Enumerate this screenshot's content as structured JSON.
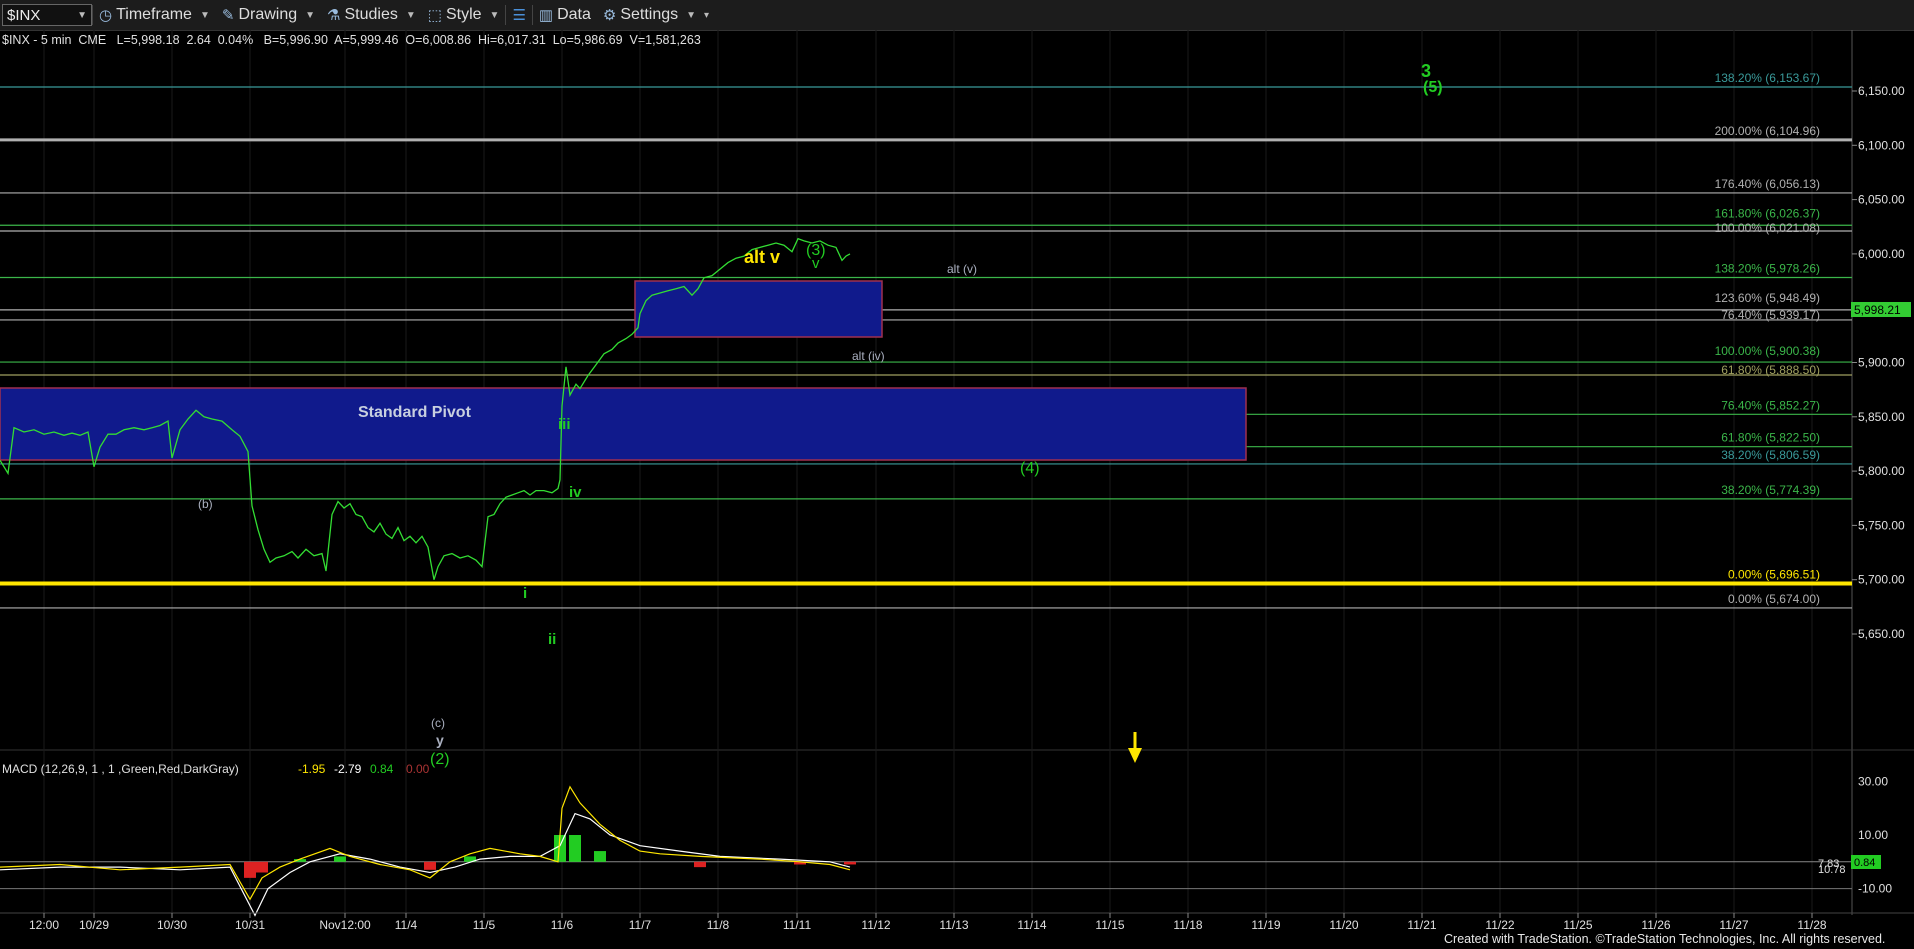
{
  "toolbar": {
    "symbol": "$INX",
    "timeframe": "Timeframe",
    "drawing": "Drawing",
    "studies": "Studies",
    "style": "Style",
    "data": "Data",
    "settings": "Settings"
  },
  "quote_line": "$INX - 5 min  CME   L=5,998.18  2.64  0.04%   B=5,996.90  A=5,999.46  O=6,008.86  Hi=6,017.31  Lo=5,986.69  V=1,581,263",
  "chart_data": {
    "type": "line",
    "symbol": "$INX",
    "interval": "5 min",
    "exchange": "CME",
    "last": "5,998.21",
    "ylim": [
      5630,
      6190
    ],
    "y_ticks": [
      "6,150.00",
      "6,100.00",
      "6,050.00",
      "6,000.00",
      "5,950.00",
      "5,900.00",
      "5,850.00",
      "5,800.00",
      "5,750.00",
      "5,700.00",
      "5,650.00"
    ],
    "x_ticks": [
      "12:00",
      "10/29",
      "10/30",
      "10/31",
      "Nov12:00",
      "11/4",
      "11/5",
      "11/6",
      "11/7",
      "11/8",
      "11/11",
      "11/12",
      "11/13",
      "11/14",
      "11/15",
      "11/18",
      "11/19",
      "11/20",
      "11/21",
      "11/22",
      "11/25",
      "11/26",
      "11/27",
      "11/28"
    ],
    "fib_levels": [
      {
        "label": "138.20% (6,153.67)",
        "price": 6153.67,
        "color": "#3a9a9a"
      },
      {
        "label": "200.00% (6,104.96)",
        "price": 6104.96,
        "color": "#b0b0b0"
      },
      {
        "label": "176.40% (6,056.13)",
        "price": 6056.13,
        "color": "#b0b0b0"
      },
      {
        "label": "161.80% (6,026.37)",
        "price": 6026.37,
        "color": "#3bb64a"
      },
      {
        "label": "100.00% (6,021.08)",
        "price": 6021.08,
        "color": "#b0b0b0"
      },
      {
        "label": "138.20% (5,978.26)",
        "price": 5978.26,
        "color": "#3bb64a"
      },
      {
        "label": "123.60% (5,948.49)",
        "price": 5948.49,
        "color": "#b0b0b0"
      },
      {
        "label": "76.40% (5,939.17)",
        "price": 5939.17,
        "color": "#b0b0b0"
      },
      {
        "label": "100.00% (5,900.38)",
        "price": 5900.38,
        "color": "#3bb64a"
      },
      {
        "label": "61.80% (5,888.50)",
        "price": 5888.5,
        "color": "#a0a060"
      },
      {
        "label": "76.40% (5,852.27)",
        "price": 5852.27,
        "color": "#3bb64a"
      },
      {
        "label": "61.80% (5,822.50)",
        "price": 5822.5,
        "color": "#3bb64a"
      },
      {
        "label": "38.20% (5,806.59)",
        "price": 5806.59,
        "color": "#3a9a9a"
      },
      {
        "label": "38.20% (5,774.39)",
        "price": 5774.39,
        "color": "#3bb64a"
      },
      {
        "label": "0.00% (5,696.51)",
        "price": 5696.51,
        "color": "#ffe600"
      },
      {
        "label": "0.00% (5,674.00)",
        "price": 5674.0,
        "color": "#b0b0b0"
      }
    ],
    "pivot_label": "Standard Pivot",
    "wave_labels": [
      {
        "text": "3",
        "color": "#22cc22"
      },
      {
        "text": "(5)",
        "color": "#22cc22"
      },
      {
        "text": "alt v",
        "color": "#ffe600"
      },
      {
        "text": "(3)",
        "color": "#22cc22"
      },
      {
        "text": "v",
        "color": "#22cc22"
      },
      {
        "text": "alt (v)",
        "color": "#aab0c0"
      },
      {
        "text": "alt (iv)",
        "color": "#aab0c0"
      },
      {
        "text": "iii",
        "color": "#22cc22"
      },
      {
        "text": "iv",
        "color": "#22cc22"
      },
      {
        "text": "(4)",
        "color": "#22cc22"
      },
      {
        "text": "(b)",
        "color": "#aab0c0"
      },
      {
        "text": "i",
        "color": "#22cc22"
      },
      {
        "text": "ii",
        "color": "#22cc22"
      },
      {
        "text": "(c)",
        "color": "#aab0c0"
      },
      {
        "text": "y",
        "color": "#aab0c0"
      },
      {
        "text": "(2)",
        "color": "#22cc22"
      }
    ],
    "price_path": [
      [
        0,
        5810
      ],
      [
        8,
        5798
      ],
      [
        14,
        5840
      ],
      [
        24,
        5836
      ],
      [
        34,
        5838
      ],
      [
        44,
        5834
      ],
      [
        54,
        5836
      ],
      [
        64,
        5833
      ],
      [
        72,
        5835
      ],
      [
        80,
        5833
      ],
      [
        88,
        5836
      ],
      [
        94,
        5804
      ],
      [
        100,
        5822
      ],
      [
        108,
        5834
      ],
      [
        116,
        5834
      ],
      [
        124,
        5838
      ],
      [
        134,
        5840
      ],
      [
        144,
        5838
      ],
      [
        152,
        5840
      ],
      [
        160,
        5842
      ],
      [
        168,
        5846
      ],
      [
        172,
        5812
      ],
      [
        180,
        5838
      ],
      [
        188,
        5848
      ],
      [
        196,
        5856
      ],
      [
        204,
        5850
      ],
      [
        212,
        5848
      ],
      [
        222,
        5846
      ],
      [
        232,
        5838
      ],
      [
        240,
        5832
      ],
      [
        248,
        5818
      ],
      [
        252,
        5768
      ],
      [
        258,
        5746
      ],
      [
        264,
        5728
      ],
      [
        270,
        5716
      ],
      [
        276,
        5720
      ],
      [
        284,
        5722
      ],
      [
        292,
        5726
      ],
      [
        298,
        5720
      ],
      [
        306,
        5728
      ],
      [
        314,
        5722
      ],
      [
        322,
        5724
      ],
      [
        326,
        5708
      ],
      [
        332,
        5760
      ],
      [
        338,
        5772
      ],
      [
        344,
        5766
      ],
      [
        350,
        5770
      ],
      [
        356,
        5760
      ],
      [
        362,
        5758
      ],
      [
        368,
        5748
      ],
      [
        374,
        5744
      ],
      [
        380,
        5752
      ],
      [
        386,
        5742
      ],
      [
        392,
        5738
      ],
      [
        398,
        5748
      ],
      [
        404,
        5736
      ],
      [
        410,
        5740
      ],
      [
        416,
        5734
      ],
      [
        422,
        5740
      ],
      [
        428,
        5730
      ],
      [
        434,
        5700
      ],
      [
        438,
        5712
      ],
      [
        444,
        5722
      ],
      [
        452,
        5724
      ],
      [
        460,
        5720
      ],
      [
        468,
        5722
      ],
      [
        476,
        5718
      ],
      [
        482,
        5712
      ],
      [
        488,
        5758
      ],
      [
        494,
        5760
      ],
      [
        500,
        5770
      ],
      [
        506,
        5776
      ],
      [
        512,
        5778
      ],
      [
        518,
        5780
      ],
      [
        524,
        5782
      ],
      [
        530,
        5778
      ],
      [
        536,
        5782
      ],
      [
        544,
        5782
      ],
      [
        552,
        5780
      ],
      [
        558,
        5784
      ],
      [
        560,
        5792
      ],
      [
        562,
        5860
      ],
      [
        566,
        5896
      ],
      [
        570,
        5870
      ],
      [
        576,
        5880
      ],
      [
        580,
        5876
      ],
      [
        588,
        5888
      ],
      [
        596,
        5898
      ],
      [
        604,
        5908
      ],
      [
        612,
        5912
      ],
      [
        618,
        5918
      ],
      [
        626,
        5922
      ],
      [
        632,
        5926
      ],
      [
        638,
        5932
      ],
      [
        640,
        5945
      ],
      [
        646,
        5957
      ],
      [
        652,
        5962
      ],
      [
        660,
        5964
      ],
      [
        668,
        5966
      ],
      [
        676,
        5968
      ],
      [
        684,
        5970
      ],
      [
        692,
        5962
      ],
      [
        698,
        5968
      ],
      [
        704,
        5978
      ],
      [
        712,
        5980
      ],
      [
        720,
        5986
      ],
      [
        728,
        5992
      ],
      [
        736,
        5996
      ],
      [
        744,
        5998
      ],
      [
        752,
        6004
      ],
      [
        760,
        6006
      ],
      [
        768,
        6008
      ],
      [
        776,
        6010
      ],
      [
        784,
        6008
      ],
      [
        792,
        6002
      ],
      [
        798,
        6014
      ],
      [
        804,
        6012
      ],
      [
        812,
        6010
      ],
      [
        820,
        6012
      ],
      [
        828,
        6008
      ],
      [
        836,
        6006
      ],
      [
        842,
        5994
      ],
      [
        846,
        5998
      ],
      [
        850,
        6000
      ]
    ],
    "macd": {
      "label": "MACD (12,26,9, 1 , 1 ,Green,Red,DarkGray)",
      "values": [
        "-1.95",
        "-2.79",
        "0.84",
        "0.00"
      ],
      "value_colors": [
        "#ffe600",
        "#ffffff",
        "#22cc22",
        "#aa3333"
      ],
      "y_ticks": [
        "30.00",
        "10.00",
        "-10.00"
      ],
      "ylim": [
        -18,
        38
      ],
      "last_labels": [
        "7.83",
        "0.84",
        "10.78"
      ],
      "macd_line": [
        [
          0,
          -2
        ],
        [
          60,
          -1
        ],
        [
          120,
          -3
        ],
        [
          180,
          -2
        ],
        [
          230,
          -1
        ],
        [
          250,
          -14
        ],
        [
          262,
          -6
        ],
        [
          280,
          -2
        ],
        [
          300,
          1
        ],
        [
          330,
          5
        ],
        [
          350,
          2
        ],
        [
          380,
          -1
        ],
        [
          410,
          -3
        ],
        [
          430,
          -6
        ],
        [
          450,
          0
        ],
        [
          470,
          3
        ],
        [
          490,
          5
        ],
        [
          520,
          3
        ],
        [
          540,
          2
        ],
        [
          558,
          0
        ],
        [
          562,
          20
        ],
        [
          570,
          28
        ],
        [
          580,
          22
        ],
        [
          600,
          14
        ],
        [
          620,
          8
        ],
        [
          640,
          4
        ],
        [
          660,
          3
        ],
        [
          700,
          2
        ],
        [
          760,
          1
        ],
        [
          800,
          0
        ],
        [
          830,
          -1
        ],
        [
          850,
          -3
        ]
      ],
      "signal_line": [
        [
          0,
          -3
        ],
        [
          60,
          -2
        ],
        [
          120,
          -2
        ],
        [
          180,
          -3
        ],
        [
          230,
          -2
        ],
        [
          255,
          -20
        ],
        [
          268,
          -10
        ],
        [
          290,
          -4
        ],
        [
          310,
          0
        ],
        [
          340,
          3
        ],
        [
          370,
          1
        ],
        [
          400,
          -2
        ],
        [
          430,
          -4
        ],
        [
          455,
          -2
        ],
        [
          480,
          1
        ],
        [
          510,
          2
        ],
        [
          540,
          2
        ],
        [
          560,
          6
        ],
        [
          575,
          18
        ],
        [
          590,
          16
        ],
        [
          610,
          10
        ],
        [
          640,
          6
        ],
        [
          680,
          4
        ],
        [
          720,
          2
        ],
        [
          780,
          1
        ],
        [
          830,
          0
        ],
        [
          850,
          -2
        ]
      ],
      "hist": [
        [
          250,
          -6
        ],
        [
          262,
          -4
        ],
        [
          300,
          1
        ],
        [
          340,
          2
        ],
        [
          430,
          -3
        ],
        [
          470,
          2
        ],
        [
          560,
          10
        ],
        [
          575,
          10
        ],
        [
          600,
          4
        ],
        [
          700,
          -2
        ],
        [
          800,
          -1
        ],
        [
          850,
          -1
        ]
      ]
    }
  },
  "footer": "Created with TradeStation. ©TradeStation Technologies, Inc. All rights reserved."
}
